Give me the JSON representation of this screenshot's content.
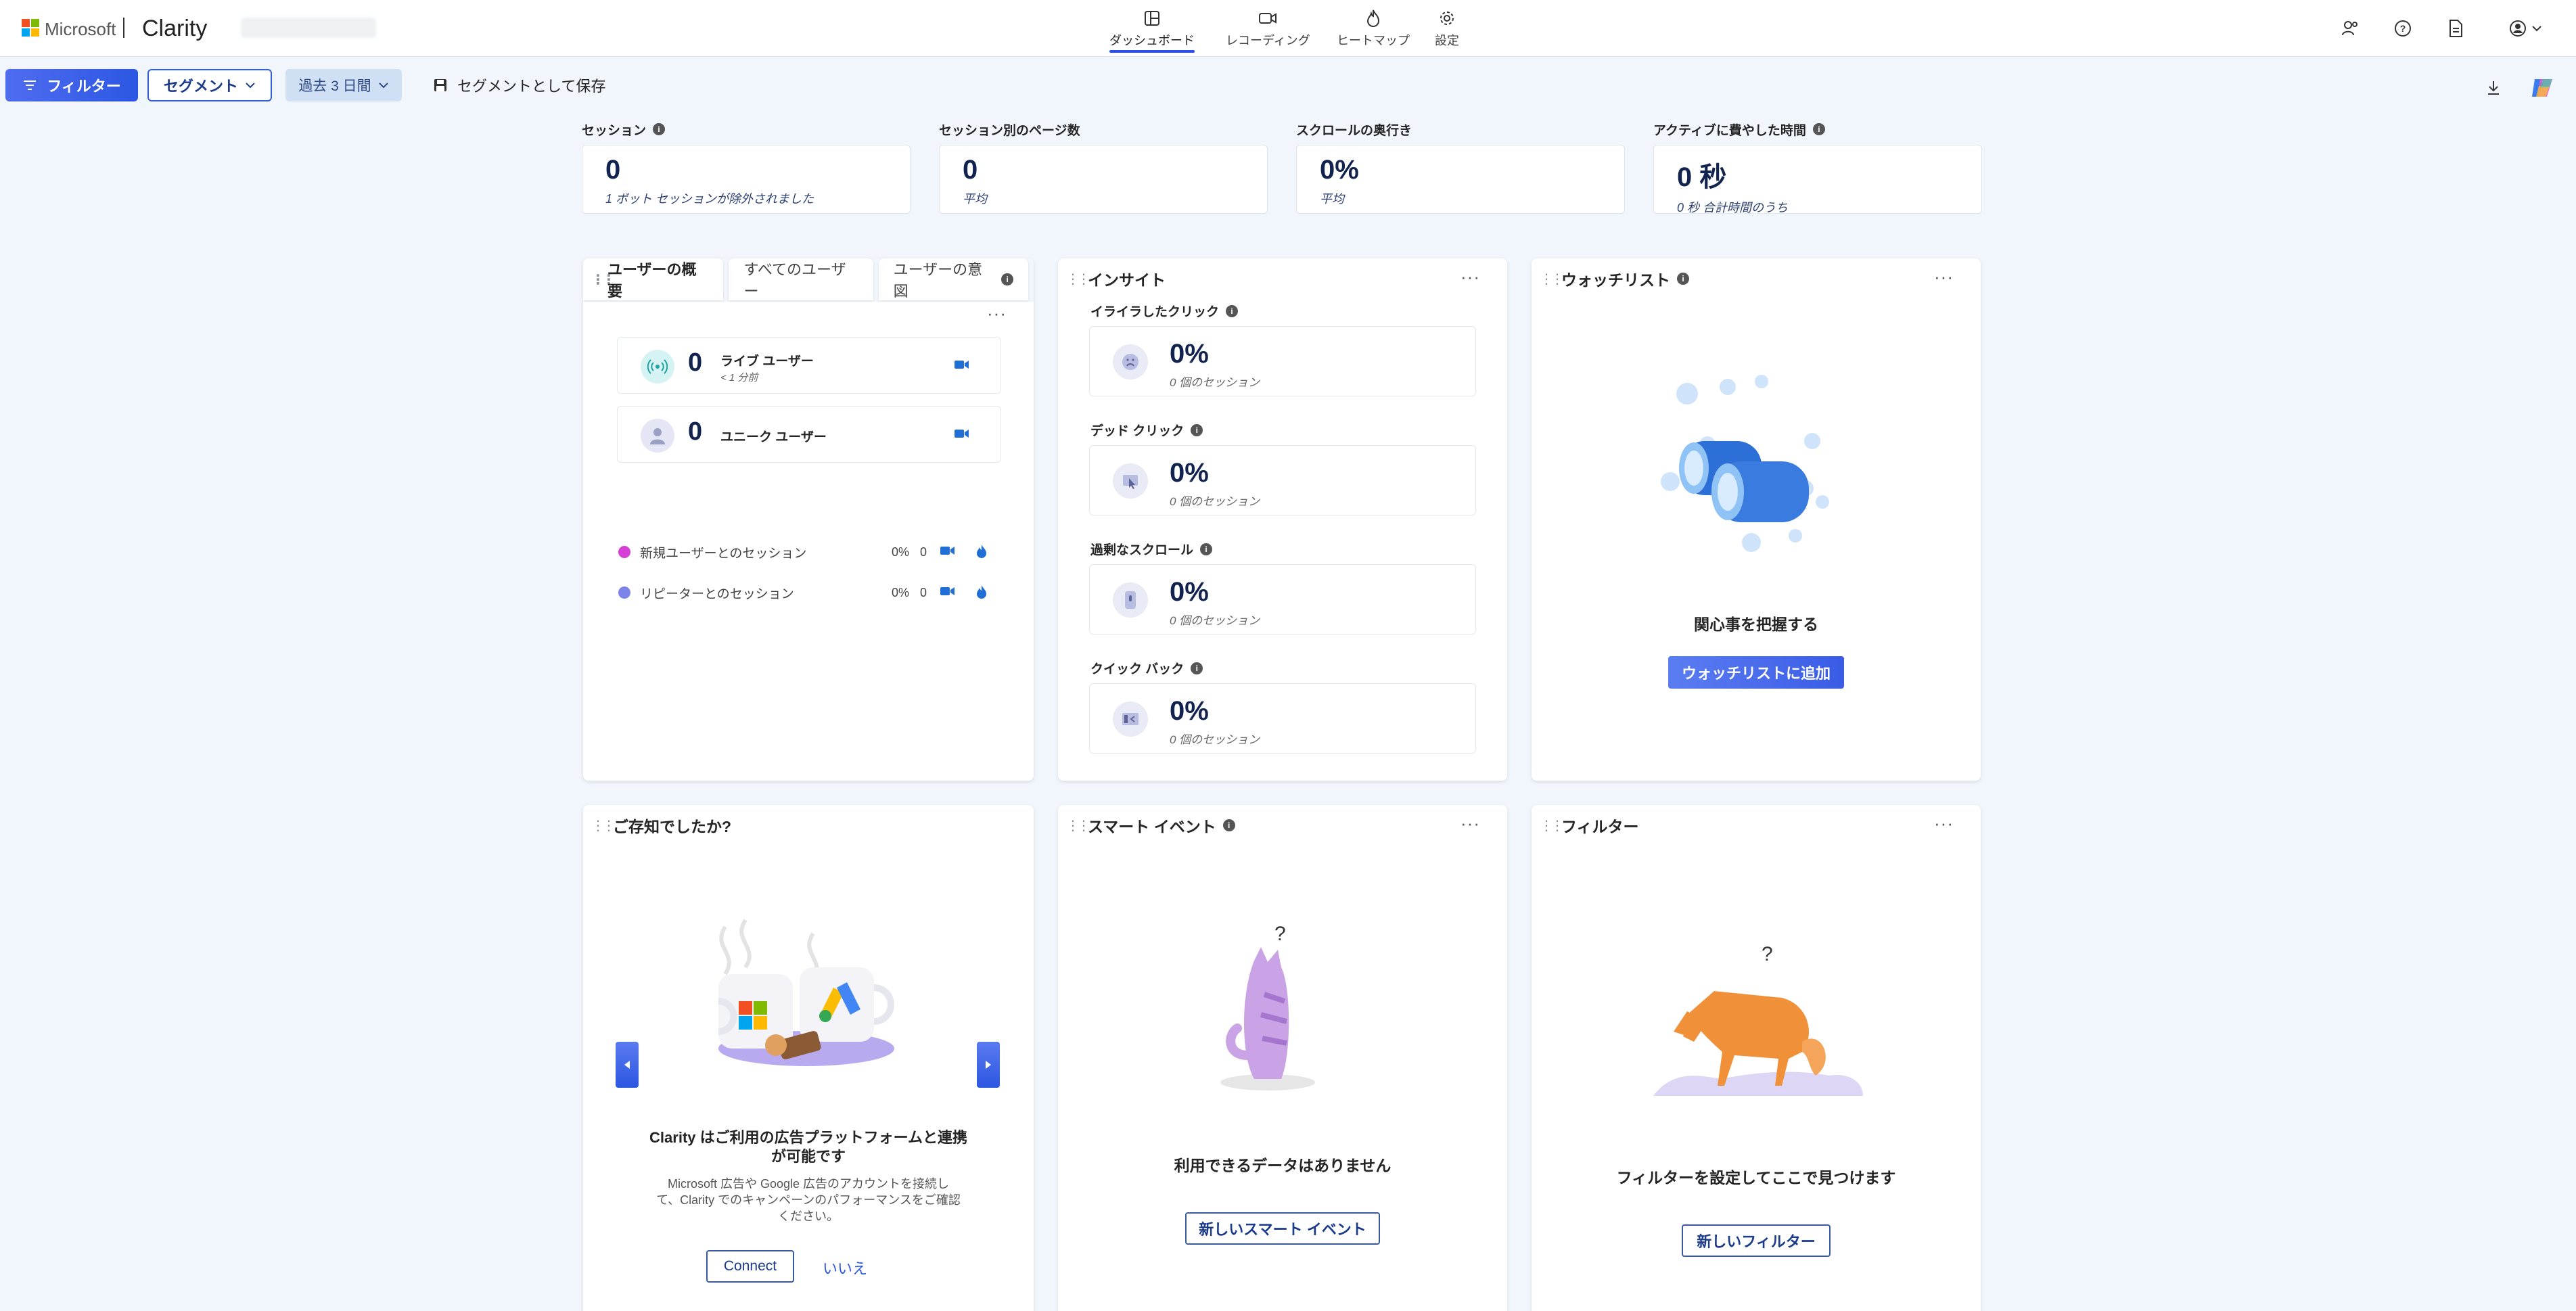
{
  "header": {
    "brand": "Microsoft",
    "product": "Clarity",
    "nav": [
      {
        "label": "ダッシュボード",
        "icon": "dashboard-icon"
      },
      {
        "label": "レコーディング",
        "icon": "video-icon"
      },
      {
        "label": "ヒートマップ",
        "icon": "flame-icon"
      },
      {
        "label": "設定",
        "icon": "gear-icon"
      }
    ]
  },
  "toolbar": {
    "filter_label": "フィルター",
    "segment_label": "セグメント",
    "range_label": "過去 3 日間",
    "save_label": "セグメントとして保存"
  },
  "metrics": [
    {
      "title": "セッション",
      "value": "0",
      "sub": "1 ボット セッションが除外されました"
    },
    {
      "title": "セッション別のページ数",
      "value": "0",
      "sub": "平均"
    },
    {
      "title": "スクロールの奥行き",
      "value": "0%",
      "sub": "平均"
    },
    {
      "title": "アクティブに費やした時間",
      "value": "0 秒",
      "sub": "0 秒 合計時間のうち"
    }
  ],
  "user_overview": {
    "tabs": [
      "ユーザーの概要",
      "すべてのユーザー",
      "ユーザーの意図"
    ],
    "live": {
      "value": "0",
      "label": "ライブ ユーザー",
      "sub": "< 1 分前"
    },
    "unique": {
      "value": "0",
      "label": "ユニーク ユーザー"
    },
    "legend": [
      {
        "label": "新規ユーザーとのセッション",
        "pct": "0%",
        "count": "0",
        "color": "#d63fd6"
      },
      {
        "label": "リピーターとのセッション",
        "pct": "0%",
        "count": "0",
        "color": "#7b83eb"
      }
    ]
  },
  "insights": {
    "title": "インサイト",
    "items": [
      {
        "label": "イライラしたクリック",
        "value": "0%",
        "sub": "0 個のセッション",
        "icon": "sad-face-icon"
      },
      {
        "label": "デッド クリック",
        "value": "0%",
        "sub": "0 個のセッション",
        "icon": "dead-click-icon"
      },
      {
        "label": "過剰なスクロール",
        "value": "0%",
        "sub": "0 個のセッション",
        "icon": "scroll-icon"
      },
      {
        "label": "クイック バック",
        "value": "0%",
        "sub": "0 個のセッション",
        "icon": "quick-back-icon"
      }
    ]
  },
  "watchlist": {
    "title": "ウォッチリスト",
    "message": "関心事を把握する",
    "button": "ウォッチリストに追加"
  },
  "did_you_know": {
    "title": "ご存知でしたか?",
    "headline_1": "Clarity はご利用の広告プラットフォームと連携",
    "headline_2": "が可能です",
    "body_1": "Microsoft 広告や Google 広告のアカウントを接続し",
    "body_2": "て、Clarity でのキャンペーンのパフォーマンスをご確認",
    "body_3": "ください。",
    "connect": "Connect",
    "no": "いいえ"
  },
  "smart_events": {
    "title": "スマート イベント",
    "message": "利用できるデータはありません",
    "button": "新しいスマート イベント"
  },
  "filters_card": {
    "title": "フィルター",
    "message": "フィルターを設定してここで見つけます",
    "button": "新しいフィルター"
  },
  "colors": {
    "accent": "#2c57e2",
    "background": "#f1f6fc",
    "text": "#242424"
  }
}
